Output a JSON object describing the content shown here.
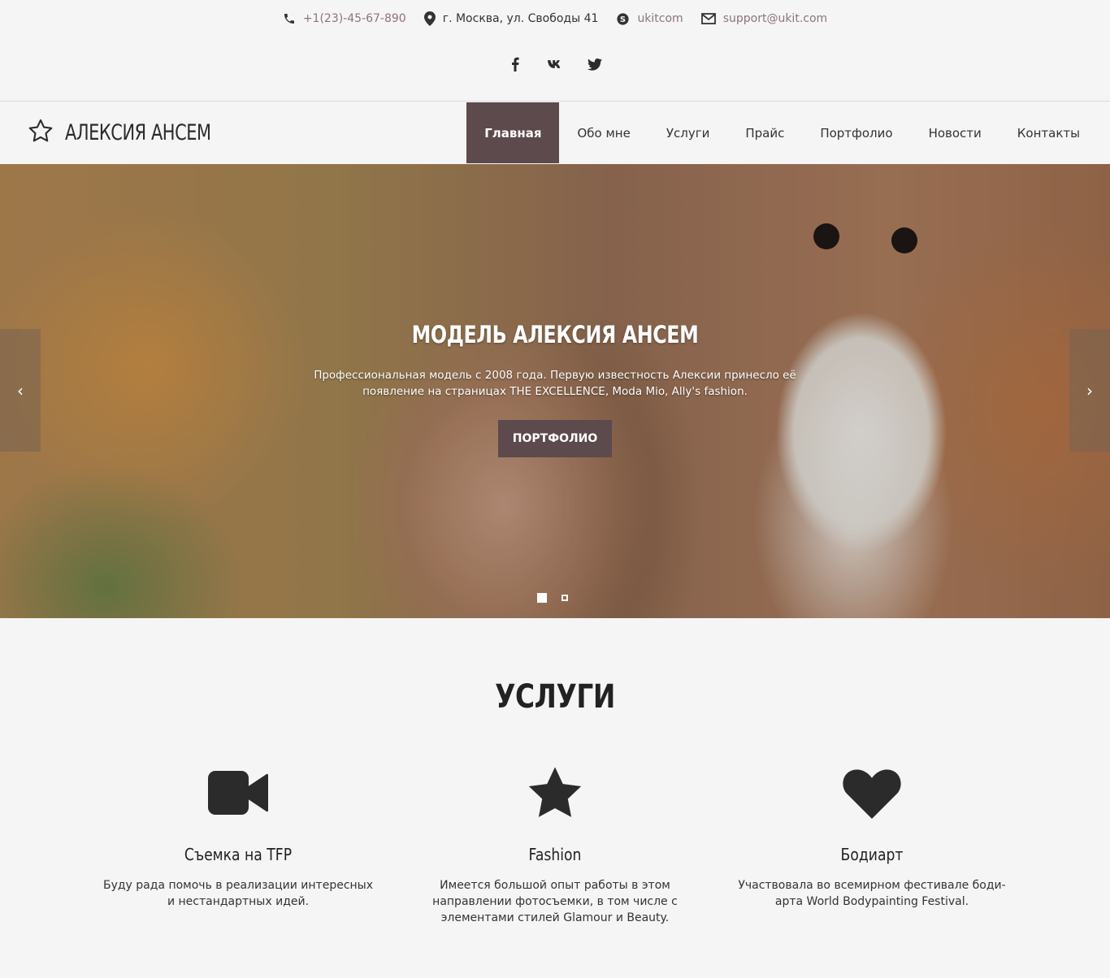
{
  "contacts": {
    "phone": "+1(23)-45-67-890",
    "address": "г. Москва, ул. Свободы 41",
    "skype": "ukitcom",
    "email": "support@ukit.com"
  },
  "socials": [
    "facebook-icon",
    "vk-icon",
    "twitter-icon"
  ],
  "logo": {
    "text": "АЛЕКСИЯ АНСЕМ"
  },
  "nav": {
    "items": [
      "Главная",
      "Обо мне",
      "Услуги",
      "Прайс",
      "Портфолио",
      "Новости",
      "Контакты"
    ],
    "active": "Главная"
  },
  "hero": {
    "title": "МОДЕЛЬ АЛЕКСИЯ АНСЕМ",
    "text": "Профессиональная модель с 2008 года. Первую известность Алексии принесло её появление на страницах THE EXCELLENCE, Moda Mio, Ally's fashion.",
    "button": "ПОРТФОЛИО",
    "prev": "‹",
    "next": "›"
  },
  "services": {
    "title": "УСЛУГИ",
    "items": [
      {
        "icon": "video-camera-icon",
        "name": "Съемка на TFP",
        "desc": "Буду рада помочь в реализации интересных и нестандартных идей."
      },
      {
        "icon": "star-icon",
        "name": "Fashion",
        "desc": "Имеется большой опыт работы в этом направлении фотосъемки, в том числе с элементами стилей Glamour и Beauty."
      },
      {
        "icon": "heart-icon",
        "name": "Бодиарт",
        "desc": "Участвовала во всемирном фестивале боди-арта World Bodypainting Festival."
      }
    ]
  },
  "colors": {
    "accent": "#5d4a4d",
    "link": "#8e7478",
    "background": "#f5f5f5"
  }
}
